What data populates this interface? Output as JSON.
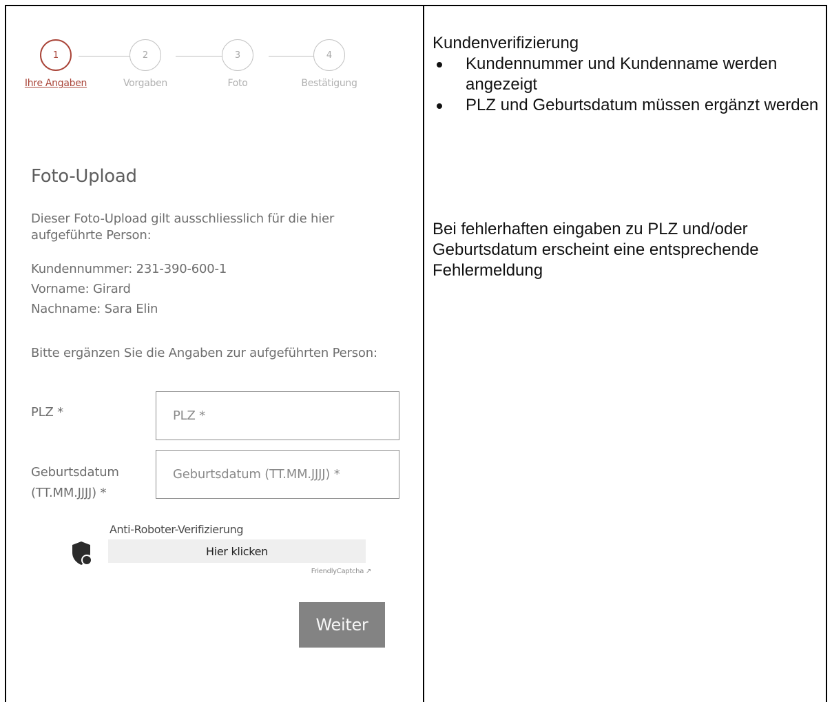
{
  "form": {
    "steps": [
      {
        "number": "1",
        "label": "Ihre Angaben"
      },
      {
        "number": "2",
        "label": "Vorgaben"
      },
      {
        "number": "3",
        "label": "Foto"
      },
      {
        "number": "4",
        "label": "Bestätigung"
      }
    ],
    "title": "Foto-Upload",
    "intro": "Dieser Foto-Upload gilt ausschliesslich für die hier aufgeführte Person:",
    "customer": {
      "number": "Kundennummer: 231-390-600-1",
      "first_name": "Vorname: Girard",
      "last_name": "Nachname: Sara Elin"
    },
    "complete_prompt": "Bitte ergänzen Sie die Angaben zur aufgeführten Person:",
    "plz": {
      "label": "PLZ *",
      "placeholder": "PLZ *",
      "value": ""
    },
    "birthdate": {
      "label_line1": "Geburtsdatum",
      "label_line2": "(TT.MM.JJJJ) *",
      "placeholder": "Geburtsdatum (TT.MM.JJJJ) *",
      "value": ""
    },
    "captcha": {
      "title": "Anti-Roboter-Verifizierung",
      "button": "Hier klicken",
      "brand": "FriendlyCaptcha ↗"
    },
    "next_button": "Weiter"
  },
  "notes": {
    "title": "Kundenverifizierung",
    "bullets": [
      "Kundennummer und Kundenname werden angezeigt",
      "PLZ und Geburtsdatum müssen ergänzt werden"
    ],
    "error_note": "Bei fehlerhaften eingaben zu PLZ und/oder Geburtsdatum erscheint eine entsprechende Fehlermeldung"
  },
  "colors": {
    "accent": "#a94438",
    "button": "#838383",
    "text_muted": "#6e6e6e"
  },
  "icons": {
    "captcha": "shield-icon"
  }
}
